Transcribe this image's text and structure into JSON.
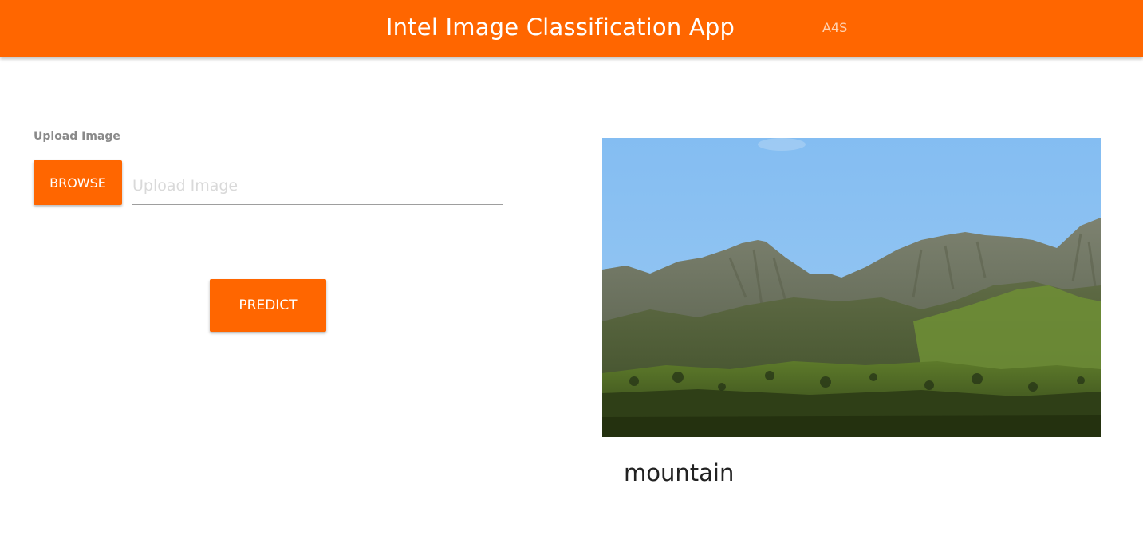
{
  "header": {
    "title": "Intel Image Classification App",
    "tag": "A4S"
  },
  "upload": {
    "label": "Upload Image",
    "browse_label": "BROWSE",
    "field_placeholder": "Upload Image",
    "field_value": ""
  },
  "actions": {
    "predict_label": "PREDICT"
  },
  "result": {
    "image_subject": "mountain landscape photo",
    "prediction": "mountain"
  },
  "colors": {
    "accent": "#ff6600",
    "header_text": "#ffffff"
  }
}
